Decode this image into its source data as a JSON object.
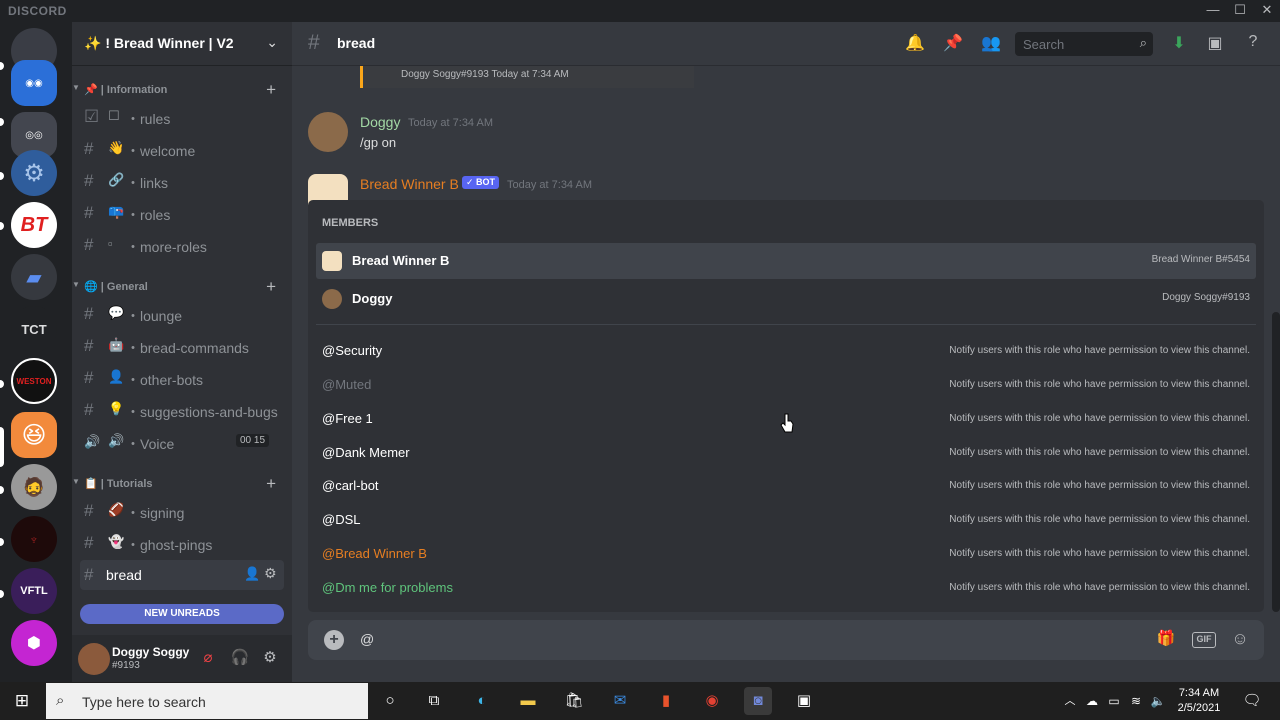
{
  "titlebar": {
    "brand": "DISCORD",
    "minimize": "—",
    "maximize": "☐",
    "close": "✕"
  },
  "servers": [
    {
      "label": "",
      "color": "#3a3d45"
    },
    {
      "label": "",
      "color": "#2b6fd8"
    },
    {
      "label": "",
      "color": "#43464f"
    },
    {
      "label": "",
      "color": "#2f5d9c"
    },
    {
      "label": "BT",
      "color": "#ffffff"
    },
    {
      "label": "▰",
      "color": "#36393f"
    },
    {
      "label": "TCT",
      "color": "#202225"
    },
    {
      "label": "WESTON",
      "color": "#222222"
    },
    {
      "label": "",
      "color": "#f28a3c"
    },
    {
      "label": "",
      "color": "#888888"
    },
    {
      "label": "",
      "color": "#1e0a0a"
    },
    {
      "label": "VFTL",
      "color": "#3a1e5a"
    },
    {
      "label": "",
      "color": "#c425d2"
    }
  ],
  "guild": {
    "name": "✨ ! Bread Winner | V2",
    "chevron": "⌄"
  },
  "categories": {
    "information": {
      "label": "📌 | Information",
      "arrow": "▼"
    },
    "general": {
      "label": "🌐 | General",
      "arrow": "▼"
    },
    "tutorials": {
      "label": "📋 | Tutorials",
      "arrow": "▼"
    }
  },
  "channels": {
    "rules": {
      "icon": "☑",
      "emoji": "☐",
      "label": "・rules"
    },
    "welcome": {
      "icon": "#",
      "emoji": "👋",
      "label": "・welcome"
    },
    "links": {
      "icon": "#",
      "emoji": "🔗",
      "label": "・links"
    },
    "roles": {
      "icon": "#",
      "emoji": "📪",
      "label": "・roles"
    },
    "more_roles": {
      "icon": "#",
      "emoji": "▫",
      "label": "・more-roles"
    },
    "lounge": {
      "icon": "#",
      "emoji": "💬",
      "label": "・lounge"
    },
    "bread_commands": {
      "icon": "#",
      "emoji": "🤖",
      "label": "・bread-commands"
    },
    "other_bots": {
      "icon": "#",
      "emoji": "👤",
      "label": "・other-bots"
    },
    "suggestions": {
      "icon": "#",
      "emoji": "💡",
      "label": "・suggestions-and-bugs"
    },
    "voice": {
      "icon": "🔊",
      "emoji": "🔊",
      "label": "・Voice",
      "count_a": "00",
      "count_b": "15"
    },
    "signing": {
      "icon": "#",
      "emoji": "🏈",
      "label": "・signing"
    },
    "ghost_pings": {
      "icon": "#",
      "emoji": "👻",
      "label": "・ghost-pings"
    },
    "bread": {
      "icon": "#",
      "label": "bread"
    }
  },
  "new_unreads": "NEW UNREADS",
  "user": {
    "name": "Doggy Soggy",
    "tag": "#9193"
  },
  "header": {
    "hash": "#",
    "title": "bread",
    "search_placeholder": "Search"
  },
  "messages": {
    "reply_preview": "Doggy Soggy#9193  Today at 7:34 AM",
    "m1": {
      "author": "Doggy",
      "author_color": "#a3d9a5",
      "time": "Today at 7:34 AM",
      "content": "/gp on"
    },
    "m2": {
      "author": "Bread Winner B",
      "author_color": "#e67e22",
      "bot": "✓ BOT",
      "time": "Today at 7:34 AM"
    }
  },
  "autocomplete": {
    "section": "MEMBERS",
    "members": [
      {
        "name": "Bread Winner B",
        "tag": "Bread Winner B#5454"
      },
      {
        "name": "Doggy",
        "tag": "Doggy Soggy#9193"
      }
    ],
    "roles": [
      {
        "name": "@Security",
        "color": "#ffffff",
        "desc": "Notify users with this role who have permission to view this channel."
      },
      {
        "name": "@Muted",
        "color": "#72767d",
        "desc": "Notify users with this role who have permission to view this channel."
      },
      {
        "name": "@Free 1",
        "color": "#ffffff",
        "desc": "Notify users with this role who have permission to view this channel."
      },
      {
        "name": "@Dank Memer",
        "color": "#ffffff",
        "desc": "Notify users with this role who have permission to view this channel."
      },
      {
        "name": "@carl-bot",
        "color": "#ffffff",
        "desc": "Notify users with this role who have permission to view this channel."
      },
      {
        "name": "@DSL",
        "color": "#ffffff",
        "desc": "Notify users with this role who have permission to view this channel."
      },
      {
        "name": "@Bread Winner B",
        "color": "#e67e22",
        "desc": "Notify users with this role who have permission to view this channel."
      },
      {
        "name": "@Dm me for problems",
        "color": "#5fc47c",
        "desc": "Notify users with this role who have permission to view this channel."
      }
    ]
  },
  "composer": {
    "value": "@"
  },
  "taskbar": {
    "search_placeholder": "Type here to search",
    "time": "7:34 AM",
    "date": "2/5/2021"
  }
}
